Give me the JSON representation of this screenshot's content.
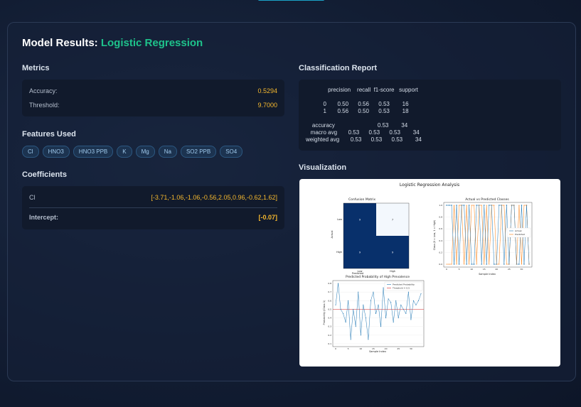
{
  "header": {
    "title_prefix": "Model Results:",
    "model_name": "Logistic Regression"
  },
  "metrics": {
    "heading": "Metrics",
    "items": [
      {
        "label": "Accuracy:",
        "value": "0.5294"
      },
      {
        "label": "Threshold:",
        "value": "9.7000"
      }
    ]
  },
  "features": {
    "heading": "Features Used",
    "items": [
      "Cl",
      "HNO3",
      "HNO3 PPB",
      "K",
      "Mg",
      "Na",
      "SO2 PPB",
      "SO4"
    ]
  },
  "coefficients": {
    "heading": "Coefficients",
    "rows": [
      {
        "label": "Cl",
        "value": "[-3.71,-1.06,-1.06,-0.56,2.05,0.96,-0.62,1.62]"
      },
      {
        "label": "Intercept:",
        "value": "[-0.07]"
      }
    ]
  },
  "report": {
    "heading": "Classification Report",
    "text": "              precision    recall  f1-score   support\n\n           0       0.50      0.56      0.53        16\n           1       0.56      0.50      0.53        18\n\n    accuracy                           0.53        34\n   macro avg       0.53      0.53      0.53        34\nweighted avg       0.53      0.53      0.53        34"
  },
  "visualization": {
    "heading": "Visualization",
    "suptitle": "Logistic Regression Analysis",
    "confusion": {
      "title": "Confusion Matrix",
      "xlabel": "Predicted",
      "ylabel": "Actual",
      "labels": [
        "Low",
        "High"
      ],
      "matrix": [
        [
          9,
          7
        ],
        [
          9,
          9
        ]
      ]
    },
    "avp": {
      "title": "Actual vs Predicted Classes",
      "xlabel": "Sample Index",
      "ylabel": "Class (0 = Low, 1 = High)",
      "legend": [
        "Actual",
        "Predicted"
      ],
      "actual": [
        1,
        1,
        1,
        0,
        1,
        0,
        1,
        1,
        0,
        1,
        0,
        0,
        1,
        1,
        0,
        1,
        0,
        1,
        1,
        0,
        0,
        1,
        1,
        0,
        1,
        0,
        1,
        1,
        0,
        0,
        1,
        0,
        1,
        0
      ],
      "predicted": [
        0,
        0,
        0,
        1,
        0,
        1,
        1,
        0,
        1,
        0,
        1,
        1,
        0,
        1,
        1,
        0,
        1,
        0,
        1,
        1,
        0,
        0,
        1,
        1,
        0,
        0,
        1,
        1,
        0,
        1,
        0,
        1,
        1,
        0
      ]
    },
    "prob": {
      "title": "Predicted Probability of High Prevalence",
      "xlabel": "Sample Index",
      "ylabel": "Probability (Class 1)",
      "legend": [
        "Predicted Probability",
        "Threshold = 0.5"
      ],
      "threshold": 0.5,
      "values": [
        0.55,
        0.8,
        0.5,
        0.45,
        0.35,
        0.6,
        0.15,
        0.5,
        0.3,
        0.7,
        0.2,
        0.55,
        0.4,
        0.15,
        0.6,
        0.7,
        0.45,
        0.55,
        0.3,
        0.75,
        0.4,
        0.62,
        0.58,
        0.35,
        0.6,
        0.4,
        0.55,
        0.5,
        0.45,
        0.7,
        0.38,
        0.6,
        0.55,
        0.6,
        0.68
      ]
    }
  }
}
